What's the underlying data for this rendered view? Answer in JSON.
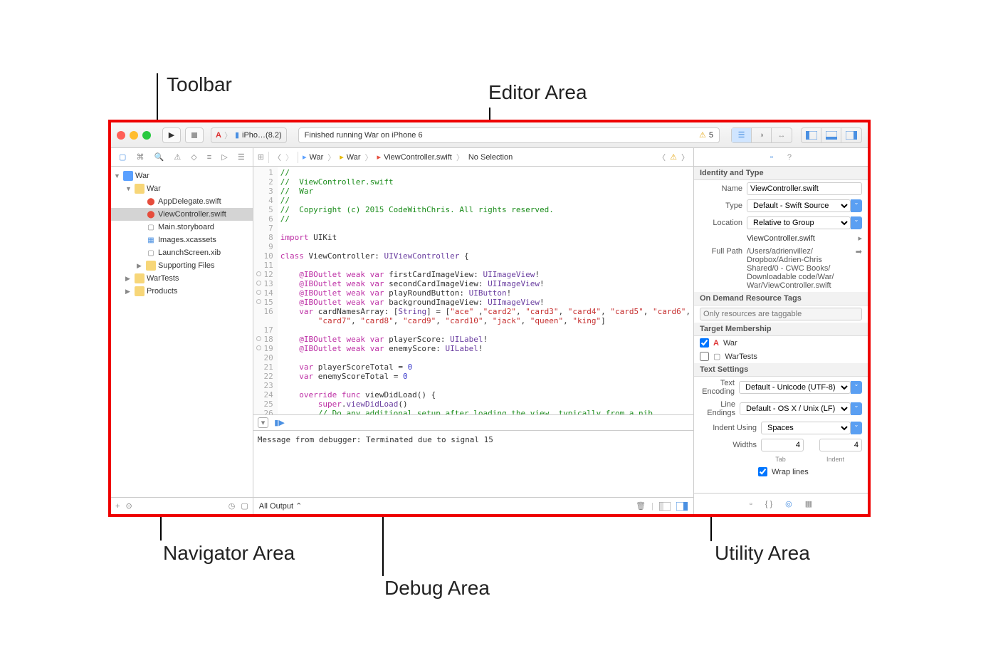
{
  "annotations": {
    "toolbar": "Toolbar",
    "editor": "Editor Area",
    "navigator": "Navigator Area",
    "debug": "Debug Area",
    "utility": "Utility Area"
  },
  "toolbar": {
    "scheme_app": "iPho…(8.2)",
    "status": "Finished running War on iPhone 6",
    "warn_count": "5"
  },
  "jumpbar": {
    "proj": "War",
    "folder": "War",
    "file": "ViewController.swift",
    "tail": "No Selection"
  },
  "tree": [
    {
      "d": 0,
      "exp": true,
      "icon": "proj",
      "label": "War"
    },
    {
      "d": 1,
      "exp": true,
      "icon": "folder",
      "label": "War"
    },
    {
      "d": 2,
      "icon": "swift",
      "label": "AppDelegate.swift"
    },
    {
      "d": 2,
      "icon": "swift",
      "label": "ViewController.swift",
      "sel": true
    },
    {
      "d": 2,
      "icon": "story",
      "label": "Main.storyboard"
    },
    {
      "d": 2,
      "icon": "assets",
      "label": "Images.xcassets"
    },
    {
      "d": 2,
      "icon": "xib",
      "label": "LaunchScreen.xib"
    },
    {
      "d": 2,
      "exp": false,
      "icon": "folder",
      "label": "Supporting Files"
    },
    {
      "d": 1,
      "exp": false,
      "icon": "folder",
      "label": "WarTests"
    },
    {
      "d": 1,
      "exp": false,
      "icon": "folder",
      "label": "Products"
    }
  ],
  "code": {
    "lines": [
      {
        "n": 1,
        "t": "//",
        "cls": "cm"
      },
      {
        "n": 2,
        "t": "//  ViewController.swift",
        "cls": "cm"
      },
      {
        "n": 3,
        "t": "//  War",
        "cls": "cm"
      },
      {
        "n": 4,
        "t": "//",
        "cls": "cm"
      },
      {
        "n": 5,
        "t": "//  Copyright (c) 2015 CodeWithChris. All rights reserved.",
        "cls": "cm"
      },
      {
        "n": 6,
        "t": "//",
        "cls": "cm"
      },
      {
        "n": 7,
        "t": ""
      },
      {
        "n": 8,
        "html": "<span class='c-kw'>import</span> UIKit"
      },
      {
        "n": 9,
        "t": ""
      },
      {
        "n": 10,
        "html": "<span class='c-kw'>class</span> ViewController: <span class='c-ty'>UIViewController</span> {"
      },
      {
        "n": 11,
        "t": ""
      },
      {
        "n": 12,
        "c": true,
        "html": "    <span class='c-kw'>@IBOutlet weak var</span> firstCardImageView: <span class='c-ty'>UIImageView</span>!"
      },
      {
        "n": 13,
        "c": true,
        "html": "    <span class='c-kw'>@IBOutlet weak var</span> secondCardImageView: <span class='c-ty'>UIImageView</span>!"
      },
      {
        "n": 14,
        "c": true,
        "html": "    <span class='c-kw'>@IBOutlet weak var</span> playRoundButton: <span class='c-ty'>UIButton</span>!"
      },
      {
        "n": 15,
        "c": true,
        "html": "    <span class='c-kw'>@IBOutlet weak var</span> backgroundImageView: <span class='c-ty'>UIImageView</span>!"
      },
      {
        "n": 16,
        "html": "    <span class='c-kw'>var</span> cardNamesArray: [<span class='c-ty'>String</span>] = [<span class='c-st'>\"ace\"</span> ,<span class='c-st'>\"card2\"</span>, <span class='c-st'>\"card3\"</span>, <span class='c-st'>\"card4\"</span>, <span class='c-st'>\"card5\"</span>, <span class='c-st'>\"card6\"</span>,\n        <span class='c-st'>\"card7\"</span>, <span class='c-st'>\"card8\"</span>, <span class='c-st'>\"card9\"</span>, <span class='c-st'>\"card10\"</span>, <span class='c-st'>\"jack\"</span>, <span class='c-st'>\"queen\"</span>, <span class='c-st'>\"king\"</span>]"
      },
      {
        "n": 17,
        "t": ""
      },
      {
        "n": 18,
        "c": true,
        "html": "    <span class='c-kw'>@IBOutlet weak var</span> playerScore: <span class='c-ty'>UILabel</span>!"
      },
      {
        "n": 19,
        "c": true,
        "html": "    <span class='c-kw'>@IBOutlet weak var</span> enemyScore: <span class='c-ty'>UILabel</span>!"
      },
      {
        "n": 20,
        "t": ""
      },
      {
        "n": 21,
        "html": "    <span class='c-kw'>var</span> playerScoreTotal = <span class='c-nm'>0</span>"
      },
      {
        "n": 22,
        "html": "    <span class='c-kw'>var</span> enemyScoreTotal = <span class='c-nm'>0</span>"
      },
      {
        "n": 23,
        "t": ""
      },
      {
        "n": 24,
        "html": "    <span class='c-kw'>override func</span> viewDidLoad() {"
      },
      {
        "n": 25,
        "html": "        <span class='c-kw'>super</span>.<span class='c-ty'>viewDidLoad</span>()"
      },
      {
        "n": 26,
        "html": "        <span class='c-cm'>// Do any additional setup after loading the view, typically from a nib.</span>"
      }
    ]
  },
  "debug": {
    "message": "Message from debugger: Terminated due to signal 15",
    "filter": "All Output"
  },
  "inspector": {
    "identity_h": "Identity and Type",
    "name_l": "Name",
    "name_v": "ViewController.swift",
    "type_l": "Type",
    "type_v": "Default - Swift Source",
    "loc_l": "Location",
    "loc_v": "Relative to Group",
    "loc_file": "ViewController.swift",
    "fp_l": "Full Path",
    "fp_v": "/Users/adrienvillez/\nDropbox/Adrien-Chris\nShared/0 - CWC Books/\nDownloadable code/War/\nWar/ViewController.swift",
    "odr_h": "On Demand Resource Tags",
    "odr_ph": "Only resources are taggable",
    "tm_h": "Target Membership",
    "tm1": "War",
    "tm2": "WarTests",
    "ts_h": "Text Settings",
    "enc_l": "Text Encoding",
    "enc_v": "Default - Unicode (UTF-8)",
    "le_l": "Line Endings",
    "le_v": "Default - OS X / Unix (LF)",
    "iu_l": "Indent Using",
    "iu_v": "Spaces",
    "w_l": "Widths",
    "tab_v": "4",
    "tab_l": "Tab",
    "ind_v": "4",
    "ind_l": "Indent",
    "wrap": "Wrap lines"
  }
}
